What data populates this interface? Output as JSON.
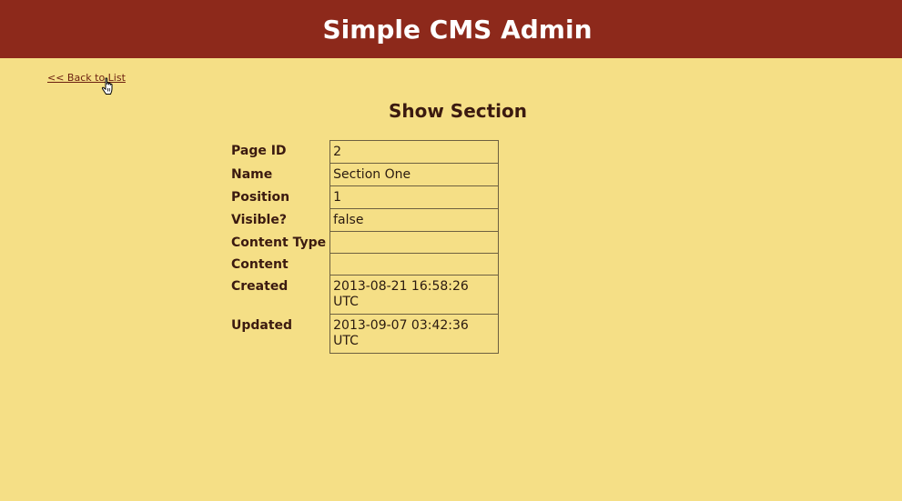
{
  "app": {
    "title": "Simple CMS Admin"
  },
  "nav": {
    "back_label": "<< Back to List"
  },
  "page": {
    "title": "Show Section"
  },
  "section": {
    "rows": [
      {
        "label": "Page ID",
        "value": "2"
      },
      {
        "label": "Name",
        "value": "Section One"
      },
      {
        "label": "Position",
        "value": "1"
      },
      {
        "label": "Visible?",
        "value": "false"
      },
      {
        "label": "Content Type",
        "value": ""
      },
      {
        "label": "Content",
        "value": ""
      },
      {
        "label": "Created",
        "value": "2013-08-21 16:58:26 UTC"
      },
      {
        "label": "Updated",
        "value": "2013-09-07 03:42:36 UTC"
      }
    ]
  },
  "colors": {
    "header_bg": "#8d291b",
    "page_bg": "#f5df86",
    "text": "#3b1a10"
  },
  "icons": {
    "cursor": "hand-pointer-icon"
  }
}
